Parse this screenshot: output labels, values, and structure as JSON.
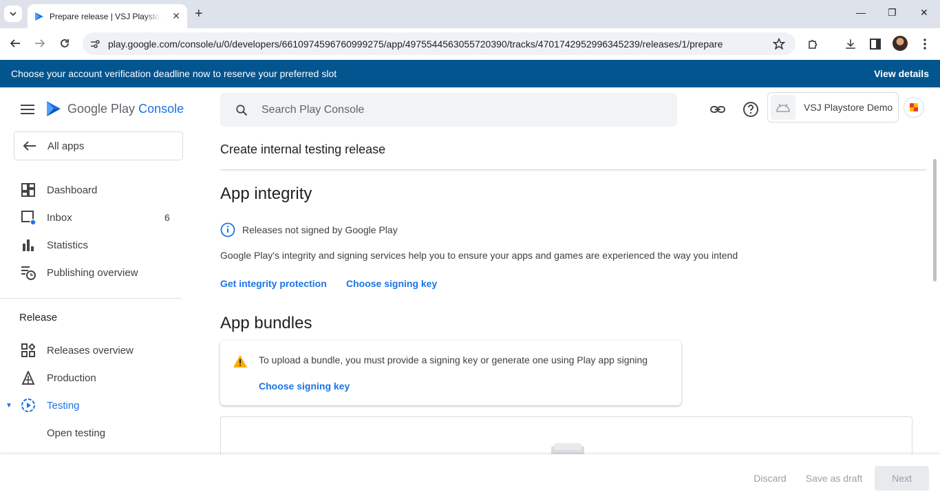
{
  "browser": {
    "tab_title": "Prepare release | VSJ Playstore Demo",
    "url": "play.google.com/console/u/0/developers/6610974596760999275/app/4975544563055720390/tracks/4701742952996345239/releases/1/prepare"
  },
  "banner": {
    "message": "Choose your account verification deadline now to reserve your preferred slot",
    "action": "View details"
  },
  "header": {
    "logo_google_play": "Google Play",
    "logo_console": "Console",
    "search_placeholder": "Search Play Console",
    "account_name": "VSJ Playstore Demo"
  },
  "sidebar": {
    "all_apps": "All apps",
    "items": [
      {
        "label": "Dashboard"
      },
      {
        "label": "Inbox",
        "count": "6"
      },
      {
        "label": "Statistics"
      },
      {
        "label": "Publishing overview"
      }
    ],
    "section": "Release",
    "release_items": [
      {
        "label": "Releases overview"
      },
      {
        "label": "Production"
      },
      {
        "label": "Testing"
      },
      {
        "label": "Open testing"
      }
    ]
  },
  "main": {
    "page_title": "Create internal testing release",
    "integrity": {
      "heading": "App integrity",
      "status": "Releases not signed by Google Play",
      "description": "Google Play's integrity and signing services help you to ensure your apps and games are experienced the way you intend",
      "link_protection": "Get integrity protection",
      "link_signing": "Choose signing key"
    },
    "bundles": {
      "heading": "App bundles",
      "warning": "To upload a bundle, you must provide a signing key or generate one using Play app signing",
      "warning_link": "Choose signing key"
    }
  },
  "footer": {
    "discard": "Discard",
    "save_draft": "Save as draft",
    "next": "Next"
  },
  "colors": {
    "banner": "#03558f",
    "accent": "#1a73e8",
    "warning": "#f9ab00"
  }
}
